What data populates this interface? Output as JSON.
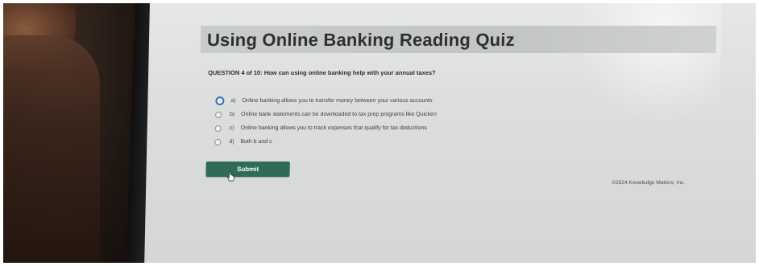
{
  "quiz": {
    "title": "Using Online Banking Reading Quiz",
    "question": "QUESTION 4 of 10: How can using online banking help with your annual taxes?",
    "options": [
      {
        "letter": "a)",
        "text": "Online banking allows you to transfer money between your various accounts",
        "selected": true
      },
      {
        "letter": "b)",
        "text": "Online bank statements can be downloaded to tax prep programs like Quicken",
        "selected": false
      },
      {
        "letter": "c)",
        "text": "Online banking allows you to track expenses that qualify for tax deductions",
        "selected": false
      },
      {
        "letter": "d)",
        "text": "Both b and c",
        "selected": false
      }
    ],
    "submit_label": "Submit",
    "copyright": "©2024 Knowledge Matters, Inc."
  },
  "colors": {
    "submit_button": "#2e6b58",
    "selected_radio": "#3e6fb4",
    "title_band": "#c9ccca"
  },
  "icons": {
    "cursor": "hand-pointer-icon"
  }
}
